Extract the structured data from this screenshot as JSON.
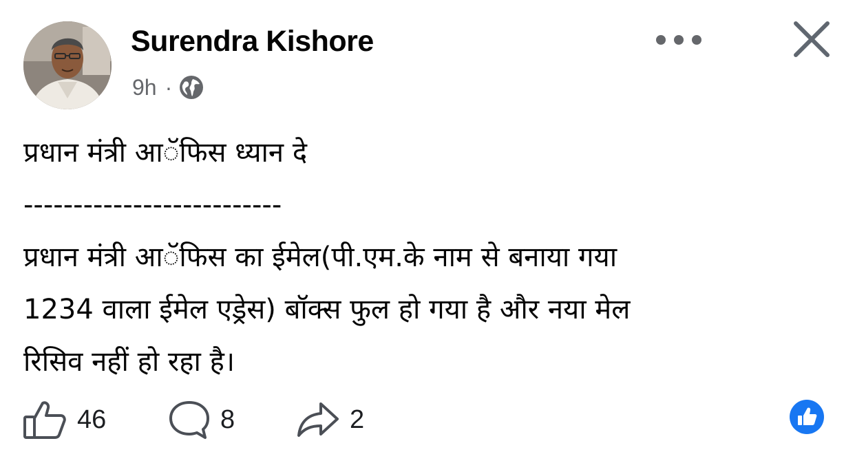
{
  "post": {
    "author": "Surendra Kishore",
    "time": "9h",
    "separator": "·",
    "privacy_icon": "globe-icon",
    "lines": [
      "प्रधान मंत्री आॅफिस ध्यान दे",
      "--------------------------",
      "प्रधान मंत्री आॅफिस का ईमेल(पी.एम.के नाम से बनाया गया",
      "1234 वाला ईमेल एड्रेस) बॉक्स फुल हो गया है और नया मेल",
      "रिसिव नहीं हो रहा है।"
    ]
  },
  "header": {
    "more_icon": "more-options-icon",
    "close_icon": "close-icon"
  },
  "actions": {
    "likes": "46",
    "comments": "8",
    "shares": "2",
    "like_icon": "thumbs-up-icon",
    "comment_icon": "comment-icon",
    "share_icon": "share-icon",
    "reaction_icon": "like-reaction-icon"
  },
  "colors": {
    "brand_blue": "#1877f2",
    "text_primary": "#050505",
    "text_secondary": "#65676b",
    "icon_gray": "#606770"
  }
}
